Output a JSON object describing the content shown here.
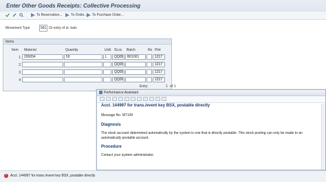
{
  "header": {
    "title": "Enter Other Goods Receipts: Collective Processing"
  },
  "toolbar": {
    "reservation": "To Reservation...",
    "order": "To Order...",
    "purchase_order": "To Purchase Order..."
  },
  "movement": {
    "label": "Movement Type",
    "code": "561",
    "description": "GI entry of st. bals"
  },
  "items": {
    "section_label": "Items",
    "columns": {
      "item": "Item",
      "material": "Material",
      "quantity": "Quantity",
      "une": "UnE",
      "sloc": "SLoc",
      "batch": "Batch",
      "re": "Re",
      "plnt": "Plnt"
    },
    "rows": [
      {
        "num": "1",
        "material": "200054",
        "quantity": "50",
        "une": "L",
        "sloc": "QQ05",
        "batch": "B01001",
        "plnt": "1217"
      },
      {
        "num": "2",
        "material": "",
        "quantity": "",
        "une": "",
        "sloc": "QQ05",
        "batch": "",
        "plnt": "1217"
      },
      {
        "num": "3",
        "material": "",
        "quantity": "",
        "une": "",
        "sloc": "QQ05",
        "batch": "",
        "plnt": "1217"
      },
      {
        "num": "4",
        "material": "",
        "quantity": "",
        "une": "",
        "sloc": "QQ05",
        "batch": "",
        "plnt": "1217"
      }
    ],
    "entry_label": "Entry",
    "entry_value": "1",
    "entry_of": "of",
    "entry_total": "1"
  },
  "perf": {
    "window_title": "Performance Assistant",
    "heading": "Acct. 144997 for trans./event key BSX, postable directly",
    "message_no": "Message No. M7109",
    "diagnosis_title": "Diagnosis",
    "diagnosis_text": "The stock account determined automatically by the system is one that is directly postable. This stock posting can only be made to an automatically postable account.",
    "procedure_title": "Procedure",
    "procedure_text": "Contact your system administrator."
  },
  "status": {
    "message": "Acct. 144997 for trans./event key BSX, postable directly"
  },
  "colors": {
    "error": "#c62828",
    "link": "#1a3a6a"
  },
  "icons": [
    "check-icon",
    "edit-icon",
    "display-icon",
    "reservation-icon",
    "order-icon",
    "purchase-order-icon",
    "error-icon"
  ]
}
